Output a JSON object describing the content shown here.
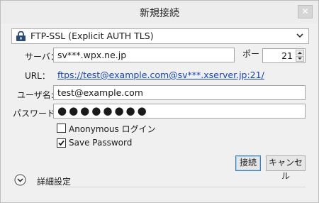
{
  "window": {
    "title": "新規接続",
    "close_label": "✕"
  },
  "protocol": {
    "selected": "FTP-SSL (Explicit AUTH TLS)"
  },
  "server": {
    "label": "サーバ：",
    "value": "sv***.wpx.ne.jp"
  },
  "port": {
    "label": "ポー",
    "value": "21"
  },
  "url": {
    "label": "URL：",
    "value": "ftps://test@example.com@sv***.xserver.jp:21/"
  },
  "username": {
    "label": "ユーザ名:",
    "value": "test@example.com"
  },
  "password": {
    "label": "パスワード:",
    "masked": "●●●●●●●●"
  },
  "options": {
    "anonymous_label": "Anonymous ログイン",
    "anonymous_checked": false,
    "save_password_label": "Save Password",
    "save_password_checked": true
  },
  "buttons": {
    "connect": "接続",
    "cancel": "キャンセル"
  },
  "advanced": {
    "label": "詳細設定"
  },
  "colors": {
    "link": "#1646b8",
    "protocol_icon": "#2a4a78"
  },
  "icons": {
    "protocol": "lock-icon",
    "select": "chevron-down-icon",
    "expander": "chevron-down-circle-icon"
  }
}
